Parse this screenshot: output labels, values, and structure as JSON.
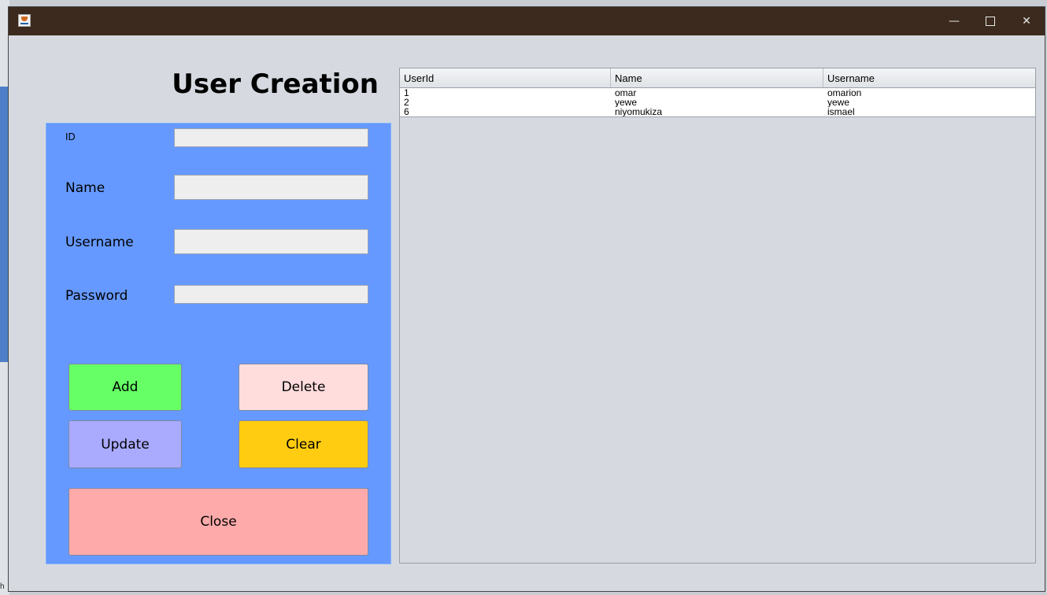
{
  "form": {
    "title": "User Creation",
    "fields": [
      {
        "label": "ID",
        "value": ""
      },
      {
        "label": "Name",
        "value": ""
      },
      {
        "label": "Username",
        "value": ""
      },
      {
        "label": "Password",
        "value": ""
      }
    ],
    "buttons": {
      "add": "Add",
      "delete": "Delete",
      "update": "Update",
      "clear": "Clear",
      "close": "Close"
    }
  },
  "table": {
    "columns": [
      "UserId",
      "Name",
      "Username"
    ],
    "rows": [
      [
        "1",
        "omar",
        "omarion"
      ],
      [
        "2",
        "yewe",
        "yewe"
      ],
      [
        "6",
        "niyomukiza",
        "ismael"
      ]
    ]
  },
  "titlebar": {
    "minimize_glyph": "—",
    "close_glyph": "✕"
  },
  "background": {
    "edge_text": "h"
  },
  "colors": {
    "title_bar": "#3b2a1d",
    "form_panel": "#6699ff",
    "add_button": "#66ff66",
    "delete_button": "#ffdddd",
    "update_button": "#aaaaff",
    "clear_button": "#ffcc11",
    "close_button": "#ffaaaa"
  },
  "icons": [
    "java-app-icon",
    "minimize-icon",
    "maximize-icon",
    "close-icon"
  ]
}
